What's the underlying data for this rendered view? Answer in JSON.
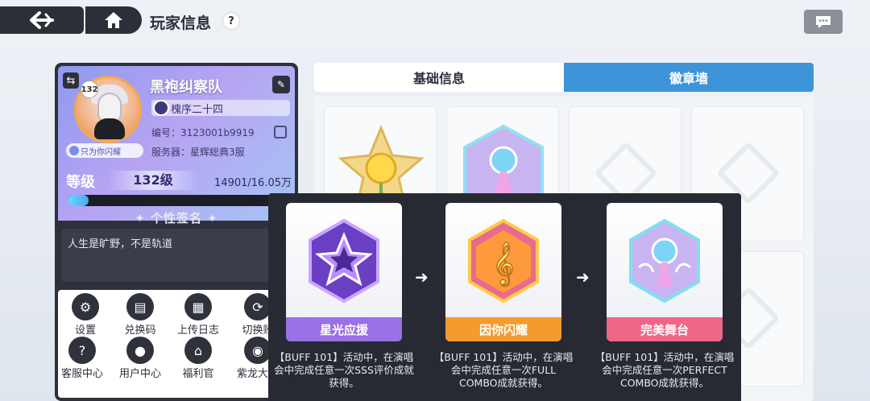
{
  "header": {
    "title": "玩家信息",
    "help": "?",
    "back_icon": "back-arrow-icon",
    "home_icon": "home-icon",
    "chat_icon": "chat-bubble-icon"
  },
  "player": {
    "name": "黑袍纠察队",
    "avatar_level": "132",
    "title_tag": "只为你闪耀",
    "guild": "槐序二十四",
    "id_row": "编号：3123001b9919",
    "server_row": "服务器：星辉総典3服",
    "level_label": "等级",
    "level_value": "132级",
    "exp_text": "14901/16.05万",
    "exp_progress": 0.093,
    "signature_title": "个性签名",
    "signature": "人生是旷野，不是轨道"
  },
  "actions": [
    {
      "label": "设置",
      "icon": "gear-icon"
    },
    {
      "label": "兑换码",
      "icon": "gift-code-icon"
    },
    {
      "label": "上传日志",
      "icon": "upload-log-icon"
    },
    {
      "label": "切换账",
      "icon": "switch-account-icon"
    },
    {
      "label": "客服中心",
      "icon": "support-icon"
    },
    {
      "label": "用户中心",
      "icon": "user-icon"
    },
    {
      "label": "福利官",
      "icon": "welfare-icon"
    },
    {
      "label": "紫龙大会",
      "icon": "dragon-icon"
    }
  ],
  "tabs": [
    {
      "label": "基础信息",
      "active": false
    },
    {
      "label": "徽章墙",
      "active": true
    }
  ],
  "badge_popup": {
    "badges": [
      {
        "name": "星光应援",
        "color": "#9b6fe6",
        "desc": "【BUFF 101】活动中，在演唱会中完成任意一次SSS评价成就获得。"
      },
      {
        "name": "因你闪耀",
        "color": "#f59a2f",
        "desc": "【BUFF 101】活动中，在演唱会中完成任意一次FULL COMBO成就获得。"
      },
      {
        "name": "完美舞台",
        "color": "#ef6688",
        "desc": "【BUFF 101】活动中，在演唱会中完成任意一次PERFECT COMBO成就获得。"
      }
    ],
    "arrow_icon": "arrow-right-icon"
  }
}
